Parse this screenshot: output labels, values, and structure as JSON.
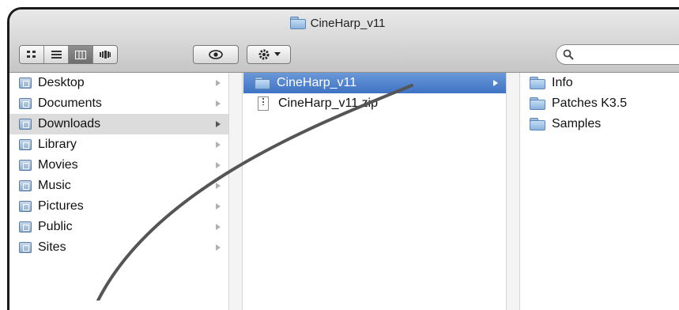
{
  "window": {
    "title": "CineHarp_v11"
  },
  "toolbar": {
    "view_buttons": [
      "icon-view",
      "list-view",
      "column-view",
      "coverflow-view"
    ],
    "active_view": 2,
    "quicklook_icon": "eye-icon",
    "action_icon": "gear-icon",
    "search": {
      "placeholder": "",
      "value": ""
    }
  },
  "sidebar": {
    "items": [
      {
        "label": "Desktop"
      },
      {
        "label": "Documents"
      },
      {
        "label": "Downloads"
      },
      {
        "label": "Library"
      },
      {
        "label": "Movies"
      },
      {
        "label": "Music"
      },
      {
        "label": "Pictures"
      },
      {
        "label": "Public"
      },
      {
        "label": "Sites"
      }
    ],
    "selected_index": 2
  },
  "column2": {
    "items": [
      {
        "label": "CineHarp_v11",
        "kind": "folder"
      },
      {
        "label": "CineHarp_v11.zip",
        "kind": "zip"
      }
    ],
    "selected_index": 0
  },
  "column3": {
    "items": [
      {
        "label": "Info"
      },
      {
        "label": "Patches K3.5"
      },
      {
        "label": "Samples"
      }
    ]
  },
  "colors": {
    "selection_blue": "#3f73c4",
    "selection_grey": "#dcdcdc",
    "annotation_stroke": "#555555"
  }
}
